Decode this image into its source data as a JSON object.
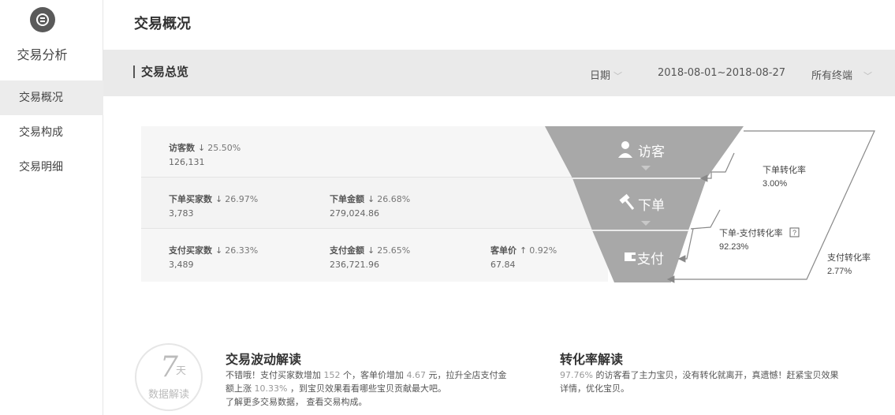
{
  "sidebar": {
    "app_title": "交易分析",
    "items": [
      {
        "label": "交易概况",
        "active": true
      },
      {
        "label": "交易构成",
        "active": false
      },
      {
        "label": "交易明细",
        "active": false
      }
    ]
  },
  "header": {
    "title": "交易概况"
  },
  "section": {
    "title": "交易总览",
    "date_label": "日期",
    "date_range": "2018-08-01~2018-08-27",
    "terminal": "所有终端"
  },
  "stats": {
    "visitors": {
      "name": "访客数",
      "change": "25.50%",
      "direction": "down",
      "value": "126,131"
    },
    "order_buyers": {
      "name": "下单买家数",
      "change": "26.97%",
      "direction": "down",
      "value": "3,783"
    },
    "order_amount": {
      "name": "下单金额",
      "change": "26.68%",
      "direction": "down",
      "value": "279,024.86"
    },
    "pay_buyers": {
      "name": "支付买家数",
      "change": "26.33%",
      "direction": "down",
      "value": "3,489"
    },
    "pay_amount": {
      "name": "支付金额",
      "change": "25.65%",
      "direction": "down",
      "value": "236,721.96"
    },
    "unit_price": {
      "name": "客单价",
      "change": "0.92%",
      "direction": "up",
      "value": "67.84"
    }
  },
  "funnel": {
    "stage1": "访客",
    "stage2": "下单",
    "stage3": "支付",
    "rate1_label": "下单转化率",
    "rate1_value": "3.00%",
    "rate2_label": "下单-支付转化率",
    "rate2_value": "92.23%",
    "rate3_label": "支付转化率",
    "rate3_value": "2.77%",
    "color": "#a8a8a8"
  },
  "badge": {
    "num": "7",
    "unit": "天",
    "text": "数据解读"
  },
  "fluctuation": {
    "title": "交易波动解读",
    "p1": "不错哦！支付买家数增加",
    "v1": "152",
    "p2": "个，客单价增加",
    "v2": "4.67",
    "p3": "元，拉升全店支付金",
    "p4": "额上涨",
    "v3": "10.33%",
    "p5": "，到宝贝效果看看哪些宝贝贡献最大吧。",
    "line3": "了解更多交易数据， 查看交易构成。"
  },
  "conversion": {
    "title": "转化率解读",
    "v1": "97.76%",
    "p1": "的访客看了主力宝贝，没有转化就离开，真遗憾！赶紧宝贝效果",
    "p2": "详情，优化宝贝。"
  }
}
